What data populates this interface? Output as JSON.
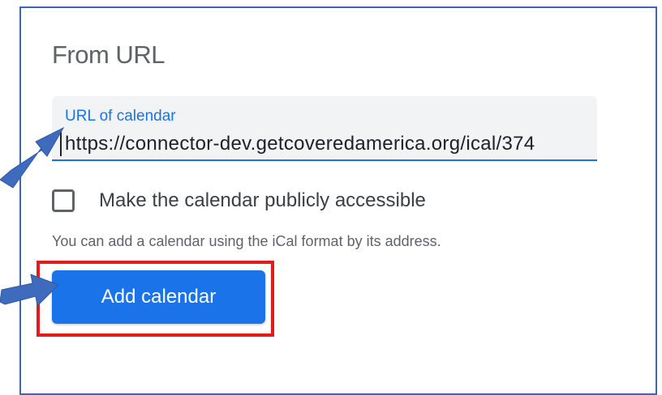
{
  "section": {
    "title": "From URL"
  },
  "url_field": {
    "label": "URL of calendar",
    "value": "https://connector-dev.getcoveredamerica.org/ical/374"
  },
  "public_checkbox": {
    "label": "Make the calendar publicly accessible",
    "checked": false
  },
  "help_text": "You can add a calendar using the iCal format by its address.",
  "add_button": {
    "label": "Add calendar"
  },
  "colors": {
    "accent": "#1a73e8",
    "highlight": "#e21b1b",
    "arrow": "#3f6bbf",
    "panel_border": "#3f66b3"
  },
  "annotations": {
    "arrows": [
      "arrow-to-url-field",
      "arrow-to-add-button"
    ],
    "highlight": "red-box-around-add-button"
  }
}
